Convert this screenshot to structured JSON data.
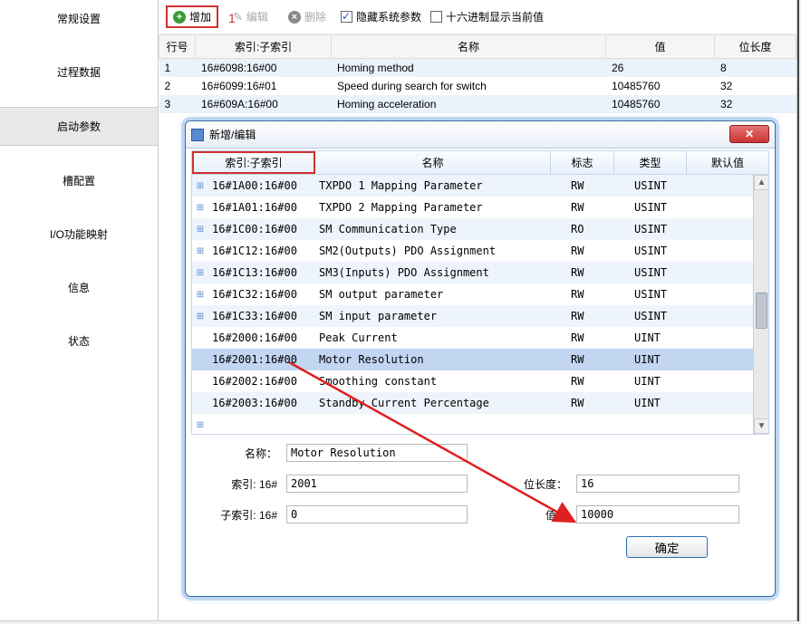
{
  "annotations": {
    "mark1": "1"
  },
  "sidebar": {
    "items": [
      {
        "label": "常规设置"
      },
      {
        "label": "过程数据"
      },
      {
        "label": "启动参数"
      },
      {
        "label": "槽配置"
      },
      {
        "label": "I/O功能映射"
      },
      {
        "label": "信息"
      },
      {
        "label": "状态"
      }
    ]
  },
  "toolbar": {
    "add": "增加",
    "edit": "编辑",
    "delete": "删除",
    "hide_sys": "隐藏系统参数",
    "hex_show": "十六进制显示当前值"
  },
  "bg_table": {
    "headers": {
      "row": "行号",
      "idx": "索引:子索引",
      "name": "名称",
      "val": "值",
      "bits": "位长度"
    },
    "rows": [
      {
        "n": "1",
        "idx": "16#6098:16#00",
        "name": "Homing method",
        "val": "26",
        "bits": "8"
      },
      {
        "n": "2",
        "idx": "16#6099:16#01",
        "name": "Speed during search for switch",
        "val": "10485760",
        "bits": "32"
      },
      {
        "n": "3",
        "idx": "16#609A:16#00",
        "name": "Homing acceleration",
        "val": "10485760",
        "bits": "32"
      }
    ]
  },
  "dialog": {
    "title": "新增/编辑",
    "grid_headers": {
      "idx": "索引:子索引",
      "name": "名称",
      "flag": "标志",
      "type": "类型",
      "def": "默认值"
    },
    "rows": [
      {
        "exp": "+",
        "idx": "16#1A00:16#00",
        "name": "TXPDO 1 Mapping Parameter",
        "flag": "RW",
        "type": "USINT"
      },
      {
        "exp": "+",
        "idx": "16#1A01:16#00",
        "name": "TXPDO 2 Mapping Parameter",
        "flag": "RW",
        "type": "USINT"
      },
      {
        "exp": "+",
        "idx": "16#1C00:16#00",
        "name": "SM Communication Type",
        "flag": "RO",
        "type": "USINT"
      },
      {
        "exp": "+",
        "idx": "16#1C12:16#00",
        "name": "SM2(Outputs) PDO Assignment",
        "flag": "RW",
        "type": "USINT"
      },
      {
        "exp": "+",
        "idx": "16#1C13:16#00",
        "name": "SM3(Inputs) PDO Assignment",
        "flag": "RW",
        "type": "USINT"
      },
      {
        "exp": "+",
        "idx": "16#1C32:16#00",
        "name": "SM output parameter",
        "flag": "RW",
        "type": "USINT"
      },
      {
        "exp": "+",
        "idx": "16#1C33:16#00",
        "name": "SM input parameter",
        "flag": "RW",
        "type": "USINT"
      },
      {
        "exp": "",
        "idx": "16#2000:16#00",
        "name": "Peak Current",
        "flag": "RW",
        "type": "UINT"
      },
      {
        "exp": "",
        "idx": "16#2001:16#00",
        "name": "Motor Resolution",
        "flag": "RW",
        "type": "UINT"
      },
      {
        "exp": "",
        "idx": "16#2002:16#00",
        "name": "Smoothing constant",
        "flag": "RW",
        "type": "UINT"
      },
      {
        "exp": "",
        "idx": "16#2003:16#00",
        "name": "Standby Current Percentage",
        "flag": "RW",
        "type": "UINT"
      }
    ],
    "form": {
      "name_label": "名称：",
      "name_value": "Motor Resolution",
      "idx_label": "索引: 16#",
      "idx_value": "2001",
      "bits_label": "位长度：",
      "bits_value": "16",
      "sub_label": "子索引: 16#",
      "sub_value": "0",
      "val_label": "值：",
      "val_value": "10000"
    },
    "ok": "确定"
  }
}
